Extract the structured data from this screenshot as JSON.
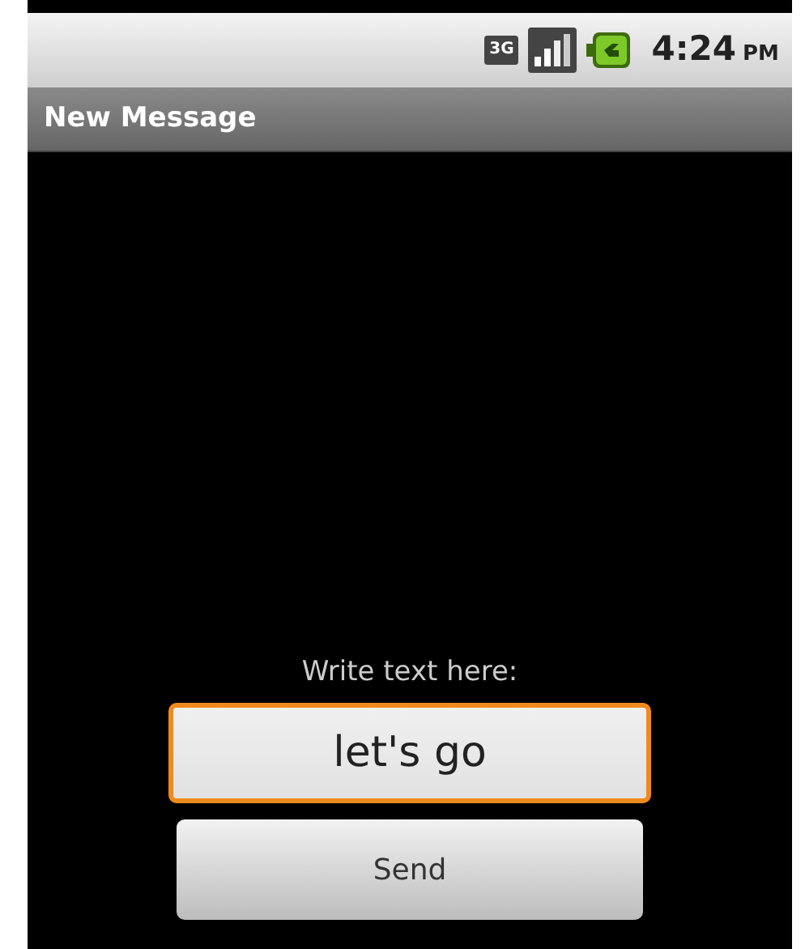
{
  "status_bar": {
    "network_type": "3G",
    "time": "4:24",
    "time_suffix": "PM"
  },
  "title_bar": {
    "title": "New Message"
  },
  "form": {
    "label": "Write text here:",
    "field": {
      "value": "let's go",
      "focused": true
    },
    "send_button": {
      "label": "Send"
    }
  }
}
